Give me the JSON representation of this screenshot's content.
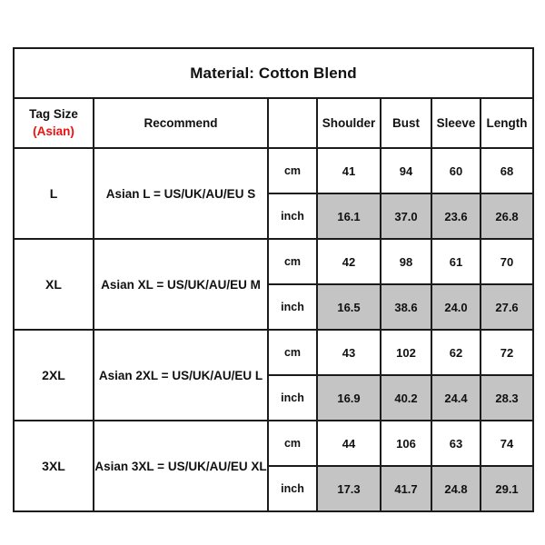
{
  "chart_data": {
    "type": "table",
    "title": "Material: Cotton Blend",
    "columns": [
      "Tag Size (Asian)",
      "Recommend",
      "",
      "Shoulder",
      "Bust",
      "Sleeve",
      "Length"
    ],
    "units": [
      "cm",
      "inch"
    ],
    "rows": [
      {
        "tag_size": "L",
        "recommend": "Asian L = US/UK/AU/EU S",
        "cm": {
          "shoulder": "41",
          "bust": "94",
          "sleeve": "60",
          "length": "68"
        },
        "inch": {
          "shoulder": "16.1",
          "bust": "37.0",
          "sleeve": "23.6",
          "length": "26.8"
        }
      },
      {
        "tag_size": "XL",
        "recommend": "Asian XL = US/UK/AU/EU M",
        "cm": {
          "shoulder": "42",
          "bust": "98",
          "sleeve": "61",
          "length": "70"
        },
        "inch": {
          "shoulder": "16.5",
          "bust": "38.6",
          "sleeve": "24.0",
          "length": "27.6"
        }
      },
      {
        "tag_size": "2XL",
        "recommend": "Asian 2XL = US/UK/AU/EU L",
        "cm": {
          "shoulder": "43",
          "bust": "102",
          "sleeve": "62",
          "length": "72"
        },
        "inch": {
          "shoulder": "16.9",
          "bust": "40.2",
          "sleeve": "24.4",
          "length": "28.3"
        }
      },
      {
        "tag_size": "3XL",
        "recommend": "Asian 3XL = US/UK/AU/EU XL",
        "cm": {
          "shoulder": "44",
          "bust": "106",
          "sleeve": "63",
          "length": "74"
        },
        "inch": {
          "shoulder": "17.3",
          "bust": "41.7",
          "sleeve": "24.8",
          "length": "29.1"
        }
      }
    ]
  },
  "table": {
    "title": "Material: Cotton Blend",
    "header": {
      "tag_size_main": "Tag Size",
      "tag_size_sub": "(Asian)",
      "recommend": "Recommend",
      "unit_blank": "",
      "shoulder": "Shoulder",
      "bust": "Bust",
      "sleeve": "Sleeve",
      "length": "Length"
    },
    "rows": [
      {
        "tag_size": "L",
        "recommend": "Asian L = US/UK/AU/EU S",
        "cm_unit": "cm",
        "cm_shoulder": "41",
        "cm_bust": "94",
        "cm_sleeve": "60",
        "cm_length": "68",
        "inch_unit": "inch",
        "inch_shoulder": "16.1",
        "inch_bust": "37.0",
        "inch_sleeve": "23.6",
        "inch_length": "26.8"
      },
      {
        "tag_size": "XL",
        "recommend": "Asian XL = US/UK/AU/EU M",
        "cm_unit": "cm",
        "cm_shoulder": "42",
        "cm_bust": "98",
        "cm_sleeve": "61",
        "cm_length": "70",
        "inch_unit": "inch",
        "inch_shoulder": "16.5",
        "inch_bust": "38.6",
        "inch_sleeve": "24.0",
        "inch_length": "27.6"
      },
      {
        "tag_size": "2XL",
        "recommend": "Asian 2XL = US/UK/AU/EU L",
        "cm_unit": "cm",
        "cm_shoulder": "43",
        "cm_bust": "102",
        "cm_sleeve": "62",
        "cm_length": "72",
        "inch_unit": "inch",
        "inch_shoulder": "16.9",
        "inch_bust": "40.2",
        "inch_sleeve": "24.4",
        "inch_length": "28.3"
      },
      {
        "tag_size": "3XL",
        "recommend": "Asian 3XL = US/UK/AU/EU XL",
        "cm_unit": "cm",
        "cm_shoulder": "44",
        "cm_bust": "106",
        "cm_sleeve": "63",
        "cm_length": "74",
        "inch_unit": "inch",
        "inch_shoulder": "17.3",
        "inch_bust": "41.7",
        "inch_sleeve": "24.8",
        "inch_length": "29.1"
      }
    ]
  },
  "colors": {
    "border": "#1b1b1b",
    "shaded_cell": "#c4c4c4",
    "accent_red": "#ee1111",
    "text": "#111111",
    "background": "#ffffff"
  }
}
